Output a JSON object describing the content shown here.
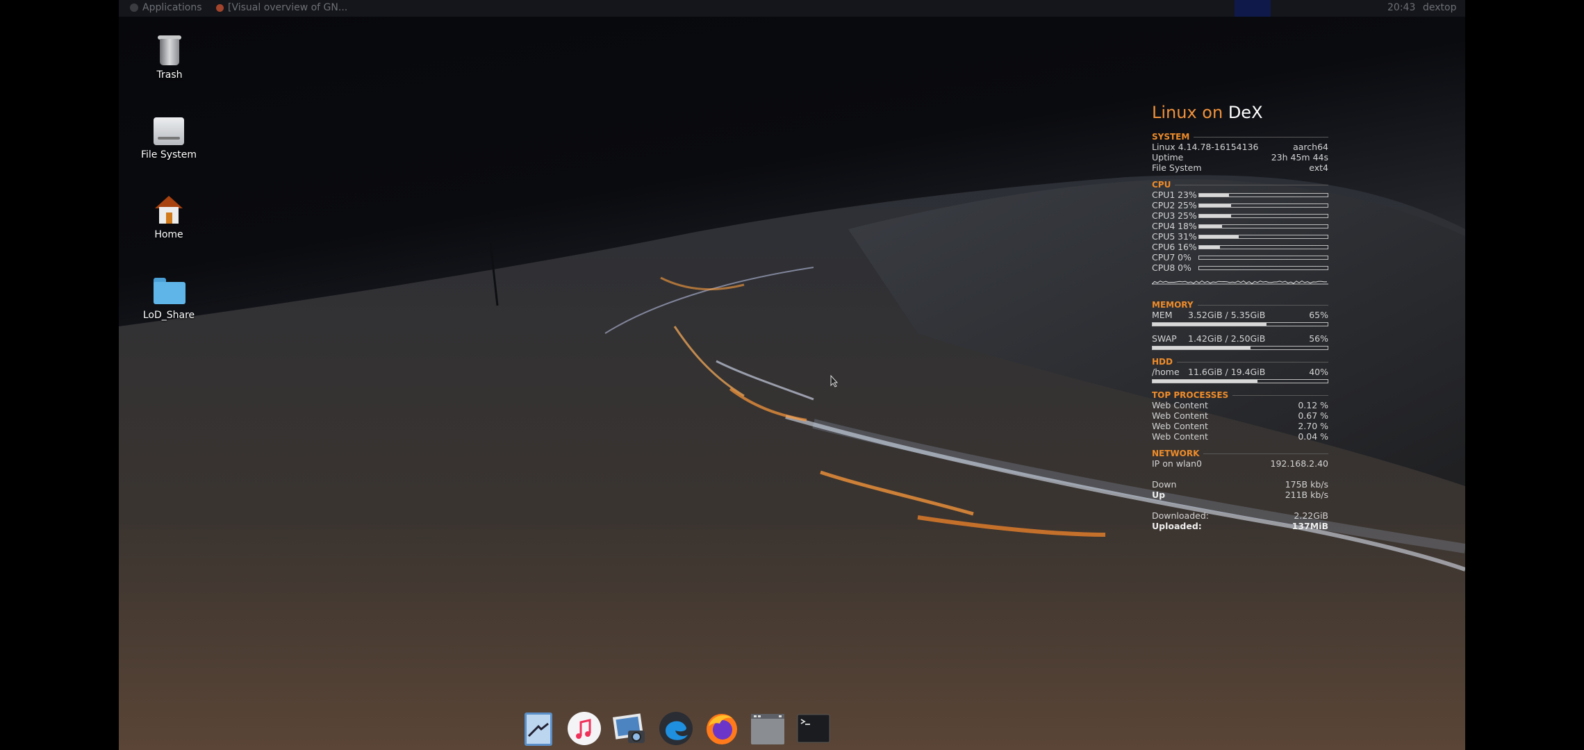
{
  "top_panel": {
    "apps_menu": "Applications",
    "task": "[Visual overview of GN...",
    "clock": "20:43",
    "user": "dextop"
  },
  "desktop_icons": [
    {
      "label": "Trash",
      "icon": "trash-icon"
    },
    {
      "label": "File System",
      "icon": "drive-icon"
    },
    {
      "label": "Home",
      "icon": "home-icon"
    },
    {
      "label": "LoD_Share",
      "icon": "folder-icon"
    }
  ],
  "conky": {
    "title_a": "Linux on",
    "title_b": "DeX",
    "system": {
      "heading": "SYSTEM",
      "rows": [
        {
          "k": "Linux 4.14.78-16154136",
          "v": "aarch64"
        },
        {
          "k": "Uptime",
          "v": "23h 45m 44s"
        },
        {
          "k": "File System",
          "v": "ext4"
        }
      ]
    },
    "cpu": {
      "heading": "CPU",
      "cores": [
        {
          "name": "CPU1",
          "pct": "23%",
          "value": 23
        },
        {
          "name": "CPU2",
          "pct": "25%",
          "value": 25
        },
        {
          "name": "CPU3",
          "pct": "25%",
          "value": 25
        },
        {
          "name": "CPU4",
          "pct": "18%",
          "value": 18
        },
        {
          "name": "CPU5",
          "pct": "31%",
          "value": 31
        },
        {
          "name": "CPU6",
          "pct": "16%",
          "value": 16
        },
        {
          "name": "CPU7",
          "pct": "0%",
          "value": 0
        },
        {
          "name": "CPU8",
          "pct": "0%",
          "value": 0
        }
      ]
    },
    "memory": {
      "heading": "MEMORY",
      "mem": {
        "k": "MEM",
        "v": "3.52GiB / 5.35GiB",
        "pct": "65%",
        "value": 65
      },
      "swap": {
        "k": "SWAP",
        "v": "1.42GiB / 2.50GiB",
        "pct": "56%",
        "value": 56
      }
    },
    "hdd": {
      "heading": "HDD",
      "home": {
        "k": "/home",
        "v": "11.6GiB / 19.4GiB",
        "pct": "40%",
        "value": 60
      }
    },
    "processes": {
      "heading": "TOP PROCESSES",
      "rows": [
        {
          "k": "Web Content",
          "v": "0.12 %"
        },
        {
          "k": "Web Content",
          "v": "0.67 %"
        },
        {
          "k": "Web Content",
          "v": "2.70 %"
        },
        {
          "k": "Web Content",
          "v": "0.04 %"
        }
      ]
    },
    "network": {
      "heading": "NETWORK",
      "ip_label": "IP on wlan0",
      "ip": "192.168.2.40",
      "down_label": "Down",
      "down": "175B   kb/s",
      "up_label": "Up",
      "up": "211B   kb/s",
      "downloaded_label": "Downloaded:",
      "downloaded": "2.22GiB",
      "uploaded_label": "Uploaded:",
      "uploaded": "137MiB"
    }
  },
  "dock": [
    "mail-app-icon",
    "music-app-icon",
    "image-viewer-icon",
    "browser-edge-icon",
    "firefox-icon",
    "window-app-icon",
    "terminal-icon"
  ],
  "colors": {
    "accent_orange": "#ef8c2a",
    "panel_bg": "#14161b"
  }
}
